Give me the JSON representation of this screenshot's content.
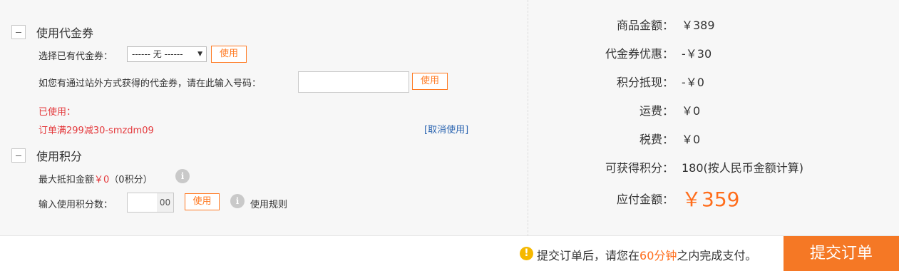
{
  "voucher": {
    "section_title": "使用代金券",
    "select_label": "选择已有代金券：",
    "select_value": "------ 无 ------",
    "use_button": "使用",
    "code_label": "如您有通过站外方式获得的代金券，请在此输入号码：",
    "code_input_value": "",
    "code_use_button": "使用",
    "used_label": "已使用：",
    "used_code": "订单满299减30-smzdm09",
    "cancel_link": "[取消使用]"
  },
  "points": {
    "section_title": "使用积分",
    "max_label": "最大抵扣金额",
    "max_amount": "￥0",
    "max_points": "（0积分）",
    "input_label": "输入使用积分数：",
    "input_value": "",
    "input_suffix": "00",
    "use_button": "使用",
    "rules_link": "使用规则"
  },
  "summary": {
    "rows": [
      {
        "label": "商品金额：",
        "value": "￥389"
      },
      {
        "label": "代金券优惠：",
        "value": "-￥30"
      },
      {
        "label": "积分抵现：",
        "value": "-￥0"
      },
      {
        "label": "运费：",
        "value": "￥0"
      },
      {
        "label": "税费：",
        "value": "￥0"
      },
      {
        "label": "可获得积分：",
        "value": "180(按人民币金额计算)"
      }
    ],
    "total_label": "应付金额：",
    "total_value": "￥359"
  },
  "footer": {
    "notice_pre": "提交订单后，请您在",
    "notice_time": "60分钟",
    "notice_post": "之内完成支付。",
    "submit_label": "提交订单"
  },
  "colors": {
    "accent": "#ff7a22",
    "submit_bg": "#f57825",
    "used_text": "#e4393c",
    "link": "#2a64b0"
  },
  "icons": [
    "collapse-icon",
    "dropdown-arrow-icon",
    "info-icon",
    "warning-icon"
  ]
}
